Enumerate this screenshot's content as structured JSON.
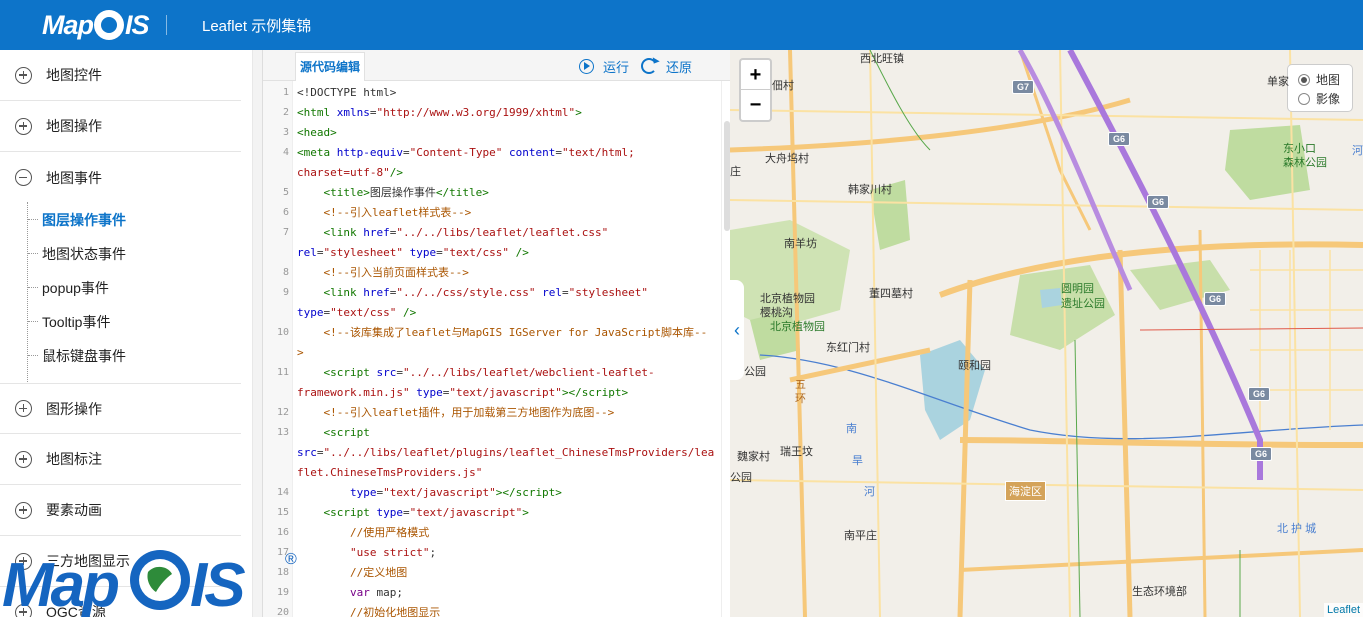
{
  "header": {
    "logo_text": "MapGIS",
    "title": "Leaflet 示例集锦"
  },
  "sidebar": {
    "menu": [
      {
        "label": "地图控件",
        "expanded": false
      },
      {
        "label": "地图操作",
        "expanded": false
      },
      {
        "label": "地图事件",
        "expanded": true
      },
      {
        "label": "图形操作",
        "expanded": false
      },
      {
        "label": "地图标注",
        "expanded": false
      },
      {
        "label": "要素动画",
        "expanded": false
      },
      {
        "label": "三方地图显示",
        "expanded": false
      },
      {
        "label": "OGC资源",
        "expanded": false
      }
    ],
    "sub_items": [
      {
        "label": "图层操作事件",
        "active": true
      },
      {
        "label": "地图状态事件",
        "active": false
      },
      {
        "label": "popup事件",
        "active": false
      },
      {
        "label": "Tooltip事件",
        "active": false
      },
      {
        "label": "鼠标键盘事件",
        "active": false
      }
    ]
  },
  "editor": {
    "tab_label": "源代码编辑",
    "run_label": "运行",
    "restore_label": "还原",
    "line_numbers": [
      "1",
      "2",
      "3",
      "4",
      "",
      "5",
      "6",
      "7",
      "",
      "8",
      "9",
      "",
      "10",
      "",
      "11",
      "",
      "12",
      "13",
      "",
      "",
      "14",
      "15",
      "16",
      "17",
      "18",
      "19",
      "20"
    ]
  },
  "map": {
    "zoom_in": "+",
    "zoom_out": "−",
    "layers": [
      {
        "label": "地图",
        "selected": true
      },
      {
        "label": "影像",
        "selected": false
      }
    ],
    "attribution": "Leaflet",
    "labels": [
      "西北旺镇",
      "佃村",
      "大舟坞村",
      "庄",
      "韩家川村",
      "南羊坊",
      "北京植物园",
      "樱桃沟",
      "北京植物园",
      "董四墓村",
      "圆明园",
      "遗址公园",
      "颐和园",
      "东红门村",
      "公园",
      "五",
      "环",
      "南",
      "旱",
      "河",
      "魏家村",
      "瑞王坟",
      "公园",
      "海淀区",
      "南平庄",
      "北 护 城",
      "生态环境部",
      "单家",
      "东小口",
      "森林公园",
      "河"
    ],
    "highways": [
      "G7",
      "G6",
      "G6",
      "G6",
      "G6",
      "G6"
    ]
  },
  "watermark": {
    "text": "MapGIS",
    "reg": "®"
  }
}
